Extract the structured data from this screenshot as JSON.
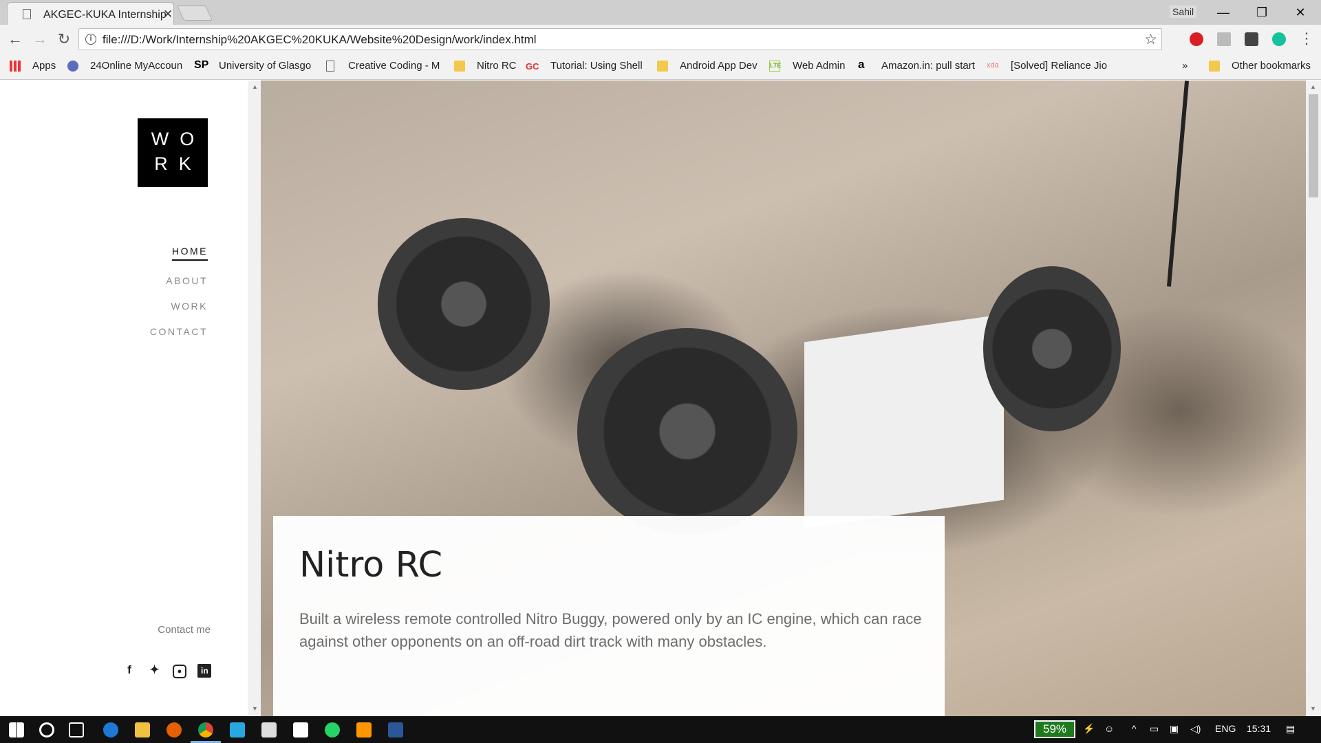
{
  "browser": {
    "tab_title": "AKGEC-KUKA Internship",
    "tab_close": "✕",
    "profile_name": "Sahil",
    "url": "file:///D:/Work/Internship%20AKGEC%20KUKA/Website%20Design/work/index.html",
    "bookmarks": [
      {
        "label": "Apps",
        "icon": "apps-grid-icon"
      },
      {
        "label": "24Online MyAccoun",
        "icon": "24online-icon"
      },
      {
        "label": "University of Glasgo",
        "icon": "sp-logo-icon"
      },
      {
        "label": "Creative Coding - M",
        "icon": "page-icon"
      },
      {
        "label": "Nitro RC",
        "icon": "folder-icon"
      },
      {
        "label": "Tutorial: Using Shell",
        "icon": "gc-icon"
      },
      {
        "label": "Android App Dev",
        "icon": "folder-icon"
      },
      {
        "label": "Web Admin",
        "icon": "lte-icon"
      },
      {
        "label": "Amazon.in: pull start",
        "icon": "amazon-icon"
      },
      {
        "label": "[Solved] Reliance Jio",
        "icon": "xda-icon"
      }
    ],
    "bookmarks_overflow": "»",
    "other_bookmarks": "Other bookmarks"
  },
  "site": {
    "logo_line1": "WO",
    "logo_line2": "RK",
    "nav": [
      {
        "label": "HOME",
        "active": true
      },
      {
        "label": "ABOUT",
        "active": false
      },
      {
        "label": "WORK",
        "active": false
      },
      {
        "label": "CONTACT",
        "active": false
      }
    ],
    "contact_me": "Contact me",
    "social": [
      "facebook-icon",
      "twitter-icon",
      "instagram-icon",
      "linkedin-icon"
    ]
  },
  "hero": {
    "title": "Nitro RC",
    "description": "Built a wireless remote controlled Nitro Buggy, powered only by an IC engine, which can race against other opponents on an off-road dirt track with many obstacles."
  },
  "taskbar": {
    "battery": "59%",
    "language": "ENG",
    "time": "15:31"
  }
}
